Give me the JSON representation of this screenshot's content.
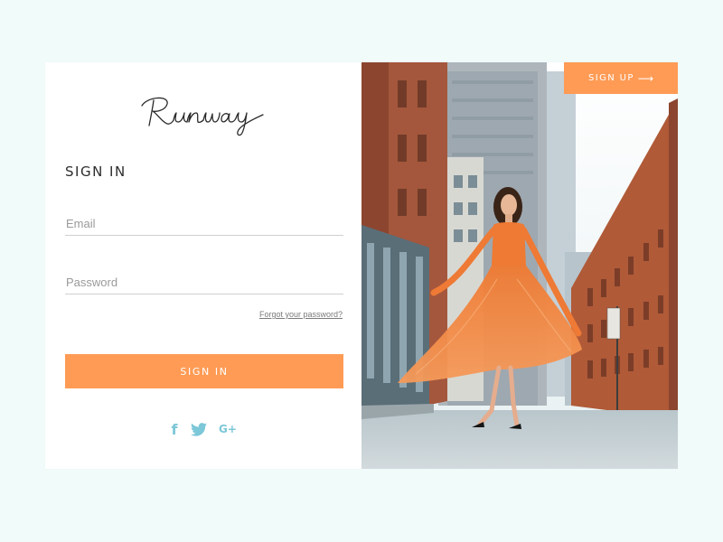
{
  "brand": {
    "logo_text": "Runway"
  },
  "signin": {
    "title": "SIGN IN",
    "email_placeholder": "Email",
    "password_placeholder": "Password",
    "forgot_link": "Forgot your password?",
    "button_label": "SIGN IN"
  },
  "social": [
    {
      "icon": "facebook-icon",
      "glyph": "f"
    },
    {
      "icon": "twitter-icon",
      "glyph": "twitter"
    },
    {
      "icon": "google-plus-icon",
      "glyph": "G+"
    }
  ],
  "signup": {
    "button_label": "SIGN UP",
    "arrow_icon": "arrow-right-icon"
  },
  "colors": {
    "accent": "#ff9b55",
    "social": "#7cc7d8",
    "background": "#f0fbfa"
  }
}
